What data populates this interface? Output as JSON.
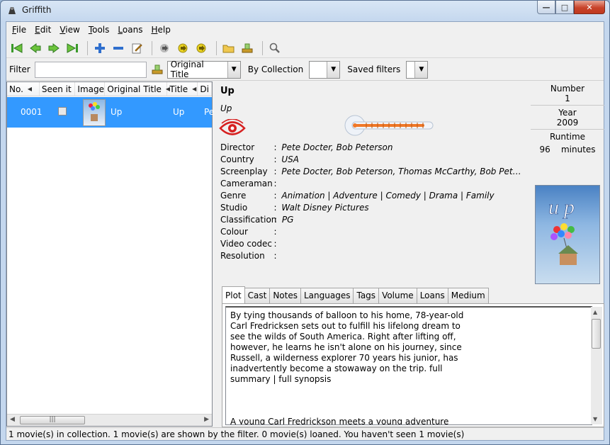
{
  "window": {
    "title": "Griffith"
  },
  "menu": [
    {
      "accel": "F",
      "rest": "ile"
    },
    {
      "accel": "E",
      "rest": "dit"
    },
    {
      "accel": "V",
      "rest": "iew"
    },
    {
      "accel": "T",
      "rest": "ools"
    },
    {
      "accel": "L",
      "rest": "oans"
    },
    {
      "accel": "H",
      "rest": "elp"
    }
  ],
  "toolbar": {
    "icons": [
      "first-icon",
      "previous-icon",
      "next-icon",
      "last-icon",
      "add-icon",
      "remove-icon",
      "edit-icon",
      "go-icon",
      "go-2-icon",
      "go-3-icon",
      "open-folder-icon",
      "scanner-icon",
      "search-icon"
    ]
  },
  "filter": {
    "label": "Filter",
    "value": "",
    "field_combo": "Original Title",
    "collection_label": "By Collection",
    "collection_value": "",
    "saved_label": "Saved filters",
    "saved_value": ""
  },
  "list": {
    "columns": [
      "No.",
      "Seen it",
      "Image",
      "Original Title",
      "Title",
      "Di"
    ],
    "rows": [
      {
        "number": "0001",
        "seen": false,
        "original_title": "Up",
        "title": "Up",
        "director": "Pe"
      }
    ]
  },
  "detail": {
    "title": "Up",
    "original_title": "Up",
    "rating": 0,
    "number_label": "Number",
    "number": "1",
    "year_label": "Year",
    "year": "2009",
    "runtime_label": "Runtime",
    "runtime": "96",
    "runtime_unit": "minutes",
    "fields": [
      {
        "label": "Director",
        "value": "Pete Docter, Bob Peterson"
      },
      {
        "label": "Country",
        "value": "USA"
      },
      {
        "label": "Screenplay",
        "value": "Pete Docter, Bob Peterson, Thomas McCarthy, Bob Peterson, Pet..."
      },
      {
        "label": "Cameraman",
        "value": ""
      },
      {
        "label": "Genre",
        "value": "Animation | Adventure | Comedy | Drama | Family"
      },
      {
        "label": "Studio",
        "value": "Walt Disney Pictures"
      },
      {
        "label": "Classification",
        "value": "PG"
      },
      {
        "label": "Colour",
        "value": ""
      },
      {
        "label": "Video codec",
        "value": ""
      },
      {
        "label": "Resolution",
        "value": ""
      }
    ],
    "tabs": [
      "Plot",
      "Cast",
      "Notes",
      "Languages",
      "Tags",
      "Volume",
      "Loans",
      "Medium"
    ],
    "active_tab": "Plot",
    "plot_p1": "By tying thousands of balloon to his home, 78-year-old Carl Fredricksen sets out to fulfill his lifelong dream to see the wilds of South America. Right after lifting off, however, he learns he isn't alone on his journey, since Russell, a wilderness explorer 70 years his junior, has inadvertently become a stowaway on the trip. full summary | full synopsis",
    "plot_p2": "A young Carl Fredrickson meets a young adventure spirited girl named Ellie. They both dream of going to a Lost Land in South America. 70 years later, Ellie has died. Carl remembers the"
  },
  "status": "1 movie(s) in collection. 1 movie(s) are shown by the filter. 0 movie(s) loaned. You haven't seen 1 movie(s)",
  "colors": {
    "selection": "#3399ff",
    "accent_red": "#d62020"
  }
}
